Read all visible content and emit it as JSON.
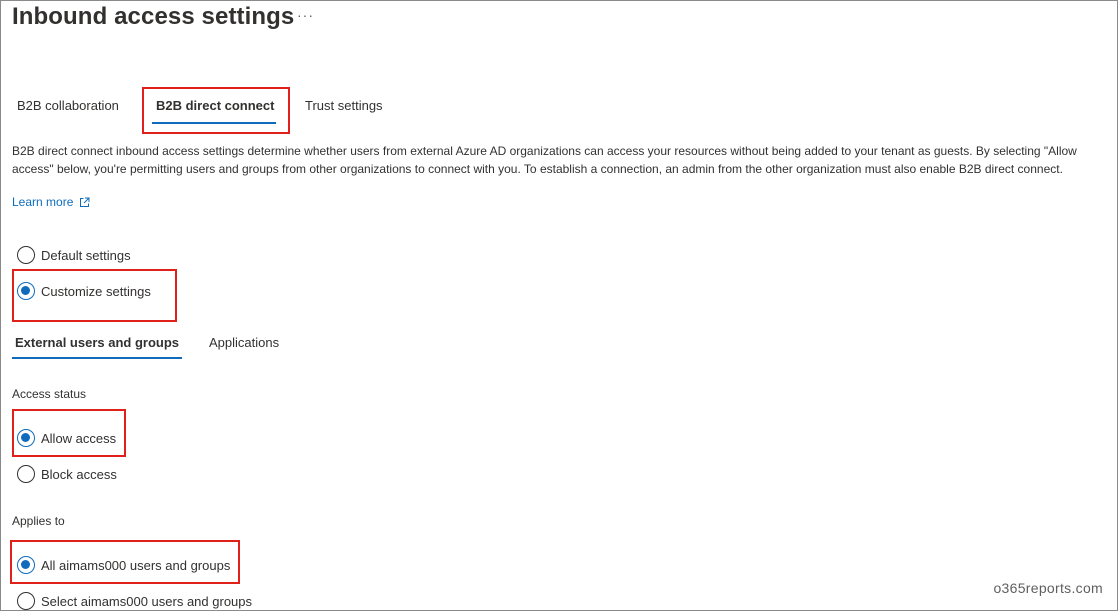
{
  "header": {
    "title": "Inbound access settings",
    "more_label": "···"
  },
  "tabs": [
    {
      "label": "B2B collaboration",
      "selected": false
    },
    {
      "label": "B2B direct connect",
      "selected": true
    },
    {
      "label": "Trust settings",
      "selected": false
    }
  ],
  "description": {
    "text": "B2B direct connect inbound access settings determine whether users from external Azure AD organizations can access your resources without being added to your tenant as guests. By selecting \"Allow access\" below, you're permitting users and groups from other organizations to connect with you. To establish a connection, an admin from the other organization must also enable B2B direct connect.",
    "learn_more": "Learn more",
    "learn_more_icon": "external-link-icon"
  },
  "settings_mode": {
    "options": [
      {
        "label": "Default settings",
        "checked": false
      },
      {
        "label": "Customize settings",
        "checked": true
      }
    ]
  },
  "subtabs": [
    {
      "label": "External users and groups",
      "selected": true
    },
    {
      "label": "Applications",
      "selected": false
    }
  ],
  "access_status": {
    "label": "Access status",
    "options": [
      {
        "label": "Allow access",
        "checked": true
      },
      {
        "label": "Block access",
        "checked": false
      }
    ]
  },
  "applies_to": {
    "label": "Applies to",
    "options": [
      {
        "label": "All aimams000 users and groups",
        "checked": true
      },
      {
        "label": "Select aimams000 users and groups",
        "checked": false
      }
    ]
  },
  "watermark": {
    "text": "o365reports.com"
  },
  "colors": {
    "accent": "#0f6cbd",
    "highlight_box": "#e0211a"
  }
}
